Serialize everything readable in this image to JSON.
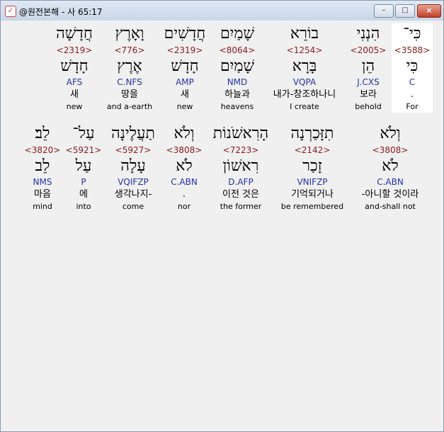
{
  "window": {
    "title": "@원전본해 - 사 65:17"
  },
  "controls": {
    "minimize": "–",
    "maximize": "□",
    "close": "×",
    "app_icon": "✓"
  },
  "rows": [
    [
      {
        "heb": "כִּי־",
        "num": "<3588>",
        "lex": "כִּי",
        "parse": "C",
        "kor": ".",
        "eng": "For",
        "highlight": true
      },
      {
        "heb": "הִנְנִי",
        "num": "<2005>",
        "lex": "הֵן",
        "parse": "J.CXS",
        "kor": "보라",
        "eng": "behold"
      },
      {
        "heb": "בוֹרֵא",
        "num": "<1254>",
        "lex": "בָּרָא",
        "parse": "VQPA",
        "kor": "내가-창조하나니",
        "eng": "I create"
      },
      {
        "heb": "שָׁמַיִם",
        "num": "<8064>",
        "lex": "שָׁמַיִם",
        "parse": "NMD",
        "kor": "하늘과",
        "eng": "heavens"
      },
      {
        "heb": "חֲדָשִׁים",
        "num": "<2319>",
        "lex": "חָדָשׁ",
        "parse": "AMP",
        "kor": "새",
        "eng": "new"
      },
      {
        "heb": "וָאָרֶץ",
        "num": "<776>",
        "lex": "אֶרֶץ",
        "parse": "C.NFS",
        "kor": "땅을",
        "eng": "and a-earth"
      },
      {
        "heb": "חֲדָשָׁה",
        "num": "<2319>",
        "lex": "חָדָשׁ",
        "parse": "AFS",
        "kor": "새",
        "eng": "new"
      }
    ],
    [
      {
        "heb": "וְלֹא",
        "num": "<3808>",
        "lex": "לֹא",
        "parse": "C.ABN",
        "kor": "-아니할 것이라",
        "eng": "and-shall not"
      },
      {
        "heb": "תִזָּכַרְנָה",
        "num": "<2142>",
        "lex": "זָכַר",
        "parse": "VNIFZP",
        "kor": "기억되거나",
        "eng": "be remembered"
      },
      {
        "heb": "הָרִאשֹׁנוֹת",
        "num": "<7223>",
        "lex": "רִאשׁוֹן",
        "parse": "D.AFP",
        "kor": "이전 것은",
        "eng": "the former"
      },
      {
        "heb": "וְלֹא",
        "num": "<3808>",
        "lex": "לֹא",
        "parse": "C.ABN",
        "kor": ".",
        "eng": "nor"
      },
      {
        "heb": "תַעֲלֶינָה",
        "num": "<5927>",
        "lex": "עָלָה",
        "parse": "VQIFZP",
        "kor": "생각나지-",
        "eng": "come"
      },
      {
        "heb": "עַל־",
        "num": "<5921>",
        "lex": "עַל",
        "parse": "P",
        "kor": "에",
        "eng": "into"
      },
      {
        "heb": "לֵב׃",
        "num": "<3820>",
        "lex": "לֵב",
        "parse": "NMS",
        "kor": "마음",
        "eng": "mind"
      }
    ]
  ]
}
